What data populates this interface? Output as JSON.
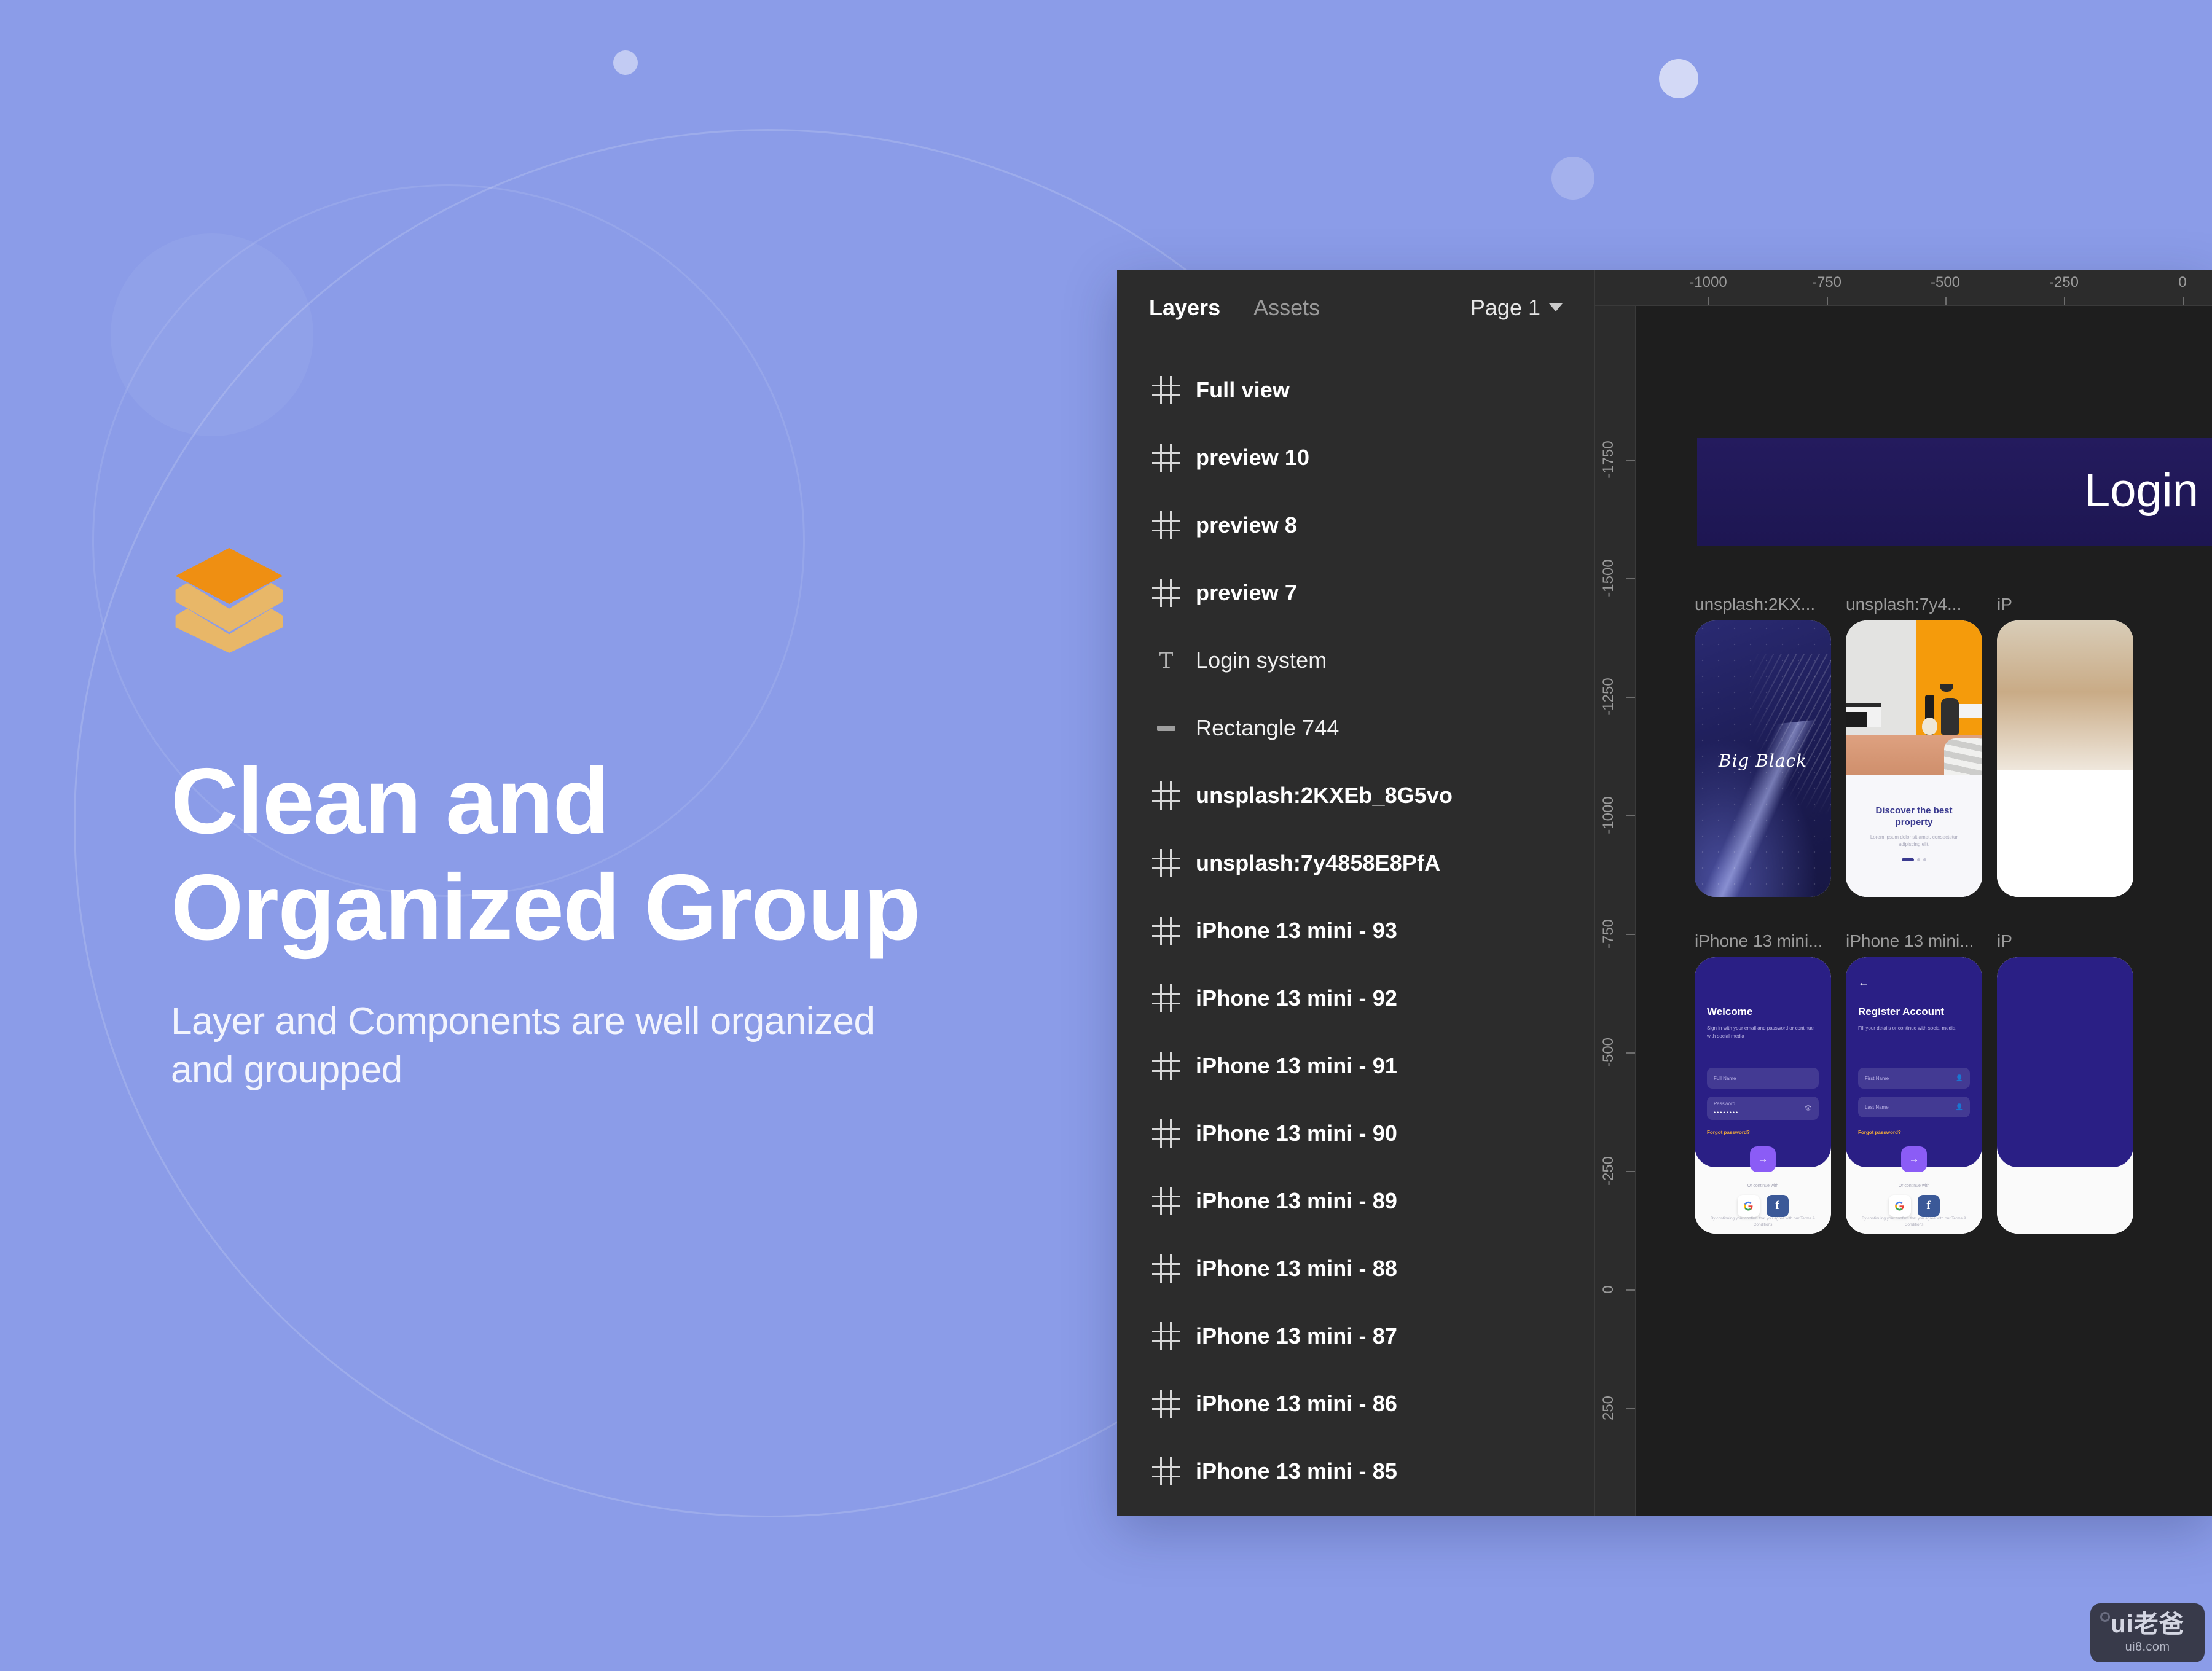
{
  "theme": {
    "background": "#8b9ce8",
    "accent_orange": "#ef8f12",
    "accent_tan": "#e8b768",
    "panel_bg": "#2c2c2c",
    "canvas_bg": "#1e1e1e",
    "brand_indigo": "#2a1f85",
    "cta_purple": "#8b5cf6"
  },
  "hero": {
    "headline": "Clean and\nOrganized Group",
    "subcopy": "Layer and Components are well organized\nand groupped",
    "logo_name": "layers-logo"
  },
  "figma": {
    "panel": {
      "tabs": [
        {
          "label": "Layers",
          "active": true
        },
        {
          "label": "Assets",
          "active": false
        }
      ],
      "page_selector": {
        "label": "Page 1",
        "chevron": "chevron-down-icon"
      },
      "layers": [
        {
          "name": "Full view",
          "icon": "frame-icon",
          "bold": true
        },
        {
          "name": "preview 10",
          "icon": "frame-icon",
          "bold": true
        },
        {
          "name": "preview 8",
          "icon": "frame-icon",
          "bold": true
        },
        {
          "name": "preview 7",
          "icon": "frame-icon",
          "bold": true
        },
        {
          "name": "Login system",
          "icon": "text-icon",
          "bold": false
        },
        {
          "name": "Rectangle 744",
          "icon": "rectangle-icon",
          "bold": false
        },
        {
          "name": "unsplash:2KXEb_8G5vo",
          "icon": "frame-icon",
          "bold": true
        },
        {
          "name": "unsplash:7y4858E8PfA",
          "icon": "frame-icon",
          "bold": true
        },
        {
          "name": "iPhone 13 mini - 93",
          "icon": "frame-icon",
          "bold": true
        },
        {
          "name": "iPhone 13 mini - 92",
          "icon": "frame-icon",
          "bold": true
        },
        {
          "name": "iPhone 13 mini - 91",
          "icon": "frame-icon",
          "bold": true
        },
        {
          "name": "iPhone 13 mini - 90",
          "icon": "frame-icon",
          "bold": true
        },
        {
          "name": "iPhone 13 mini - 89",
          "icon": "frame-icon",
          "bold": true
        },
        {
          "name": "iPhone 13 mini - 88",
          "icon": "frame-icon",
          "bold": true
        },
        {
          "name": "iPhone 13 mini - 87",
          "icon": "frame-icon",
          "bold": true
        },
        {
          "name": "iPhone 13 mini - 86",
          "icon": "frame-icon",
          "bold": true
        },
        {
          "name": "iPhone 13 mini - 85",
          "icon": "frame-icon",
          "bold": true
        }
      ]
    },
    "ruler_horizontal": [
      "-1000",
      "-750",
      "-500",
      "-250",
      "0"
    ],
    "ruler_vertical": [
      "-1750",
      "-1500",
      "-1250",
      "-1000",
      "-750",
      "-500",
      "-250",
      "0",
      "250"
    ],
    "canvas": {
      "hero_banner": {
        "title": "Login system"
      },
      "frames": [
        {
          "label": "unsplash:2KX...",
          "kind": "splash"
        },
        {
          "label": "unsplash:7y4...",
          "kind": "property"
        },
        {
          "label": "iP",
          "kind": "property-partial"
        },
        {
          "label": "iPhone 13 mini...",
          "kind": "welcome"
        },
        {
          "label": "iPhone 13 mini...",
          "kind": "register"
        },
        {
          "label": "iP",
          "kind": "auth-partial"
        }
      ],
      "splash": {
        "title": "Big Black"
      },
      "property": {
        "title": "Discover the best property",
        "body": "Lorem ipsum dolor sit amet, consectetur adipiscing elit.",
        "dots": 3,
        "active_dot": 1
      },
      "welcome": {
        "title": "Welcome",
        "subtitle": "Sign in with your email and password or continue with social media",
        "fields": [
          {
            "label": "Full Name",
            "value": "",
            "icon": ""
          },
          {
            "label": "Password",
            "value": "••••••••",
            "icon": "eye-off-icon"
          }
        ],
        "forgot": "Forgot password?",
        "cta_icon": "arrow-right-icon",
        "divider": "Or continue with",
        "social": [
          {
            "name": "google-icon",
            "glyph": "G"
          },
          {
            "name": "facebook-icon",
            "glyph": "f"
          }
        ],
        "legal": "By continuing your confirm that you agree with our Terms & Conditions"
      },
      "register": {
        "back_icon": "arrow-left-icon",
        "title": "Register Account",
        "subtitle": "Fill your details or continue with social media",
        "fields": [
          {
            "label": "First Name",
            "value": "",
            "icon": "person-icon"
          },
          {
            "label": "Last Name",
            "value": "",
            "icon": "person-icon"
          }
        ],
        "forgot": "Forgot password?",
        "cta_icon": "arrow-right-icon",
        "divider": "Or continue with",
        "social": [
          {
            "name": "google-icon",
            "glyph": "G"
          },
          {
            "name": "facebook-icon",
            "glyph": "f"
          }
        ],
        "legal": "By continuing your confirm that you agree with our Terms & Conditions"
      }
    }
  },
  "watermark": {
    "main": "ui老爸",
    "sub": "ui8.com"
  }
}
